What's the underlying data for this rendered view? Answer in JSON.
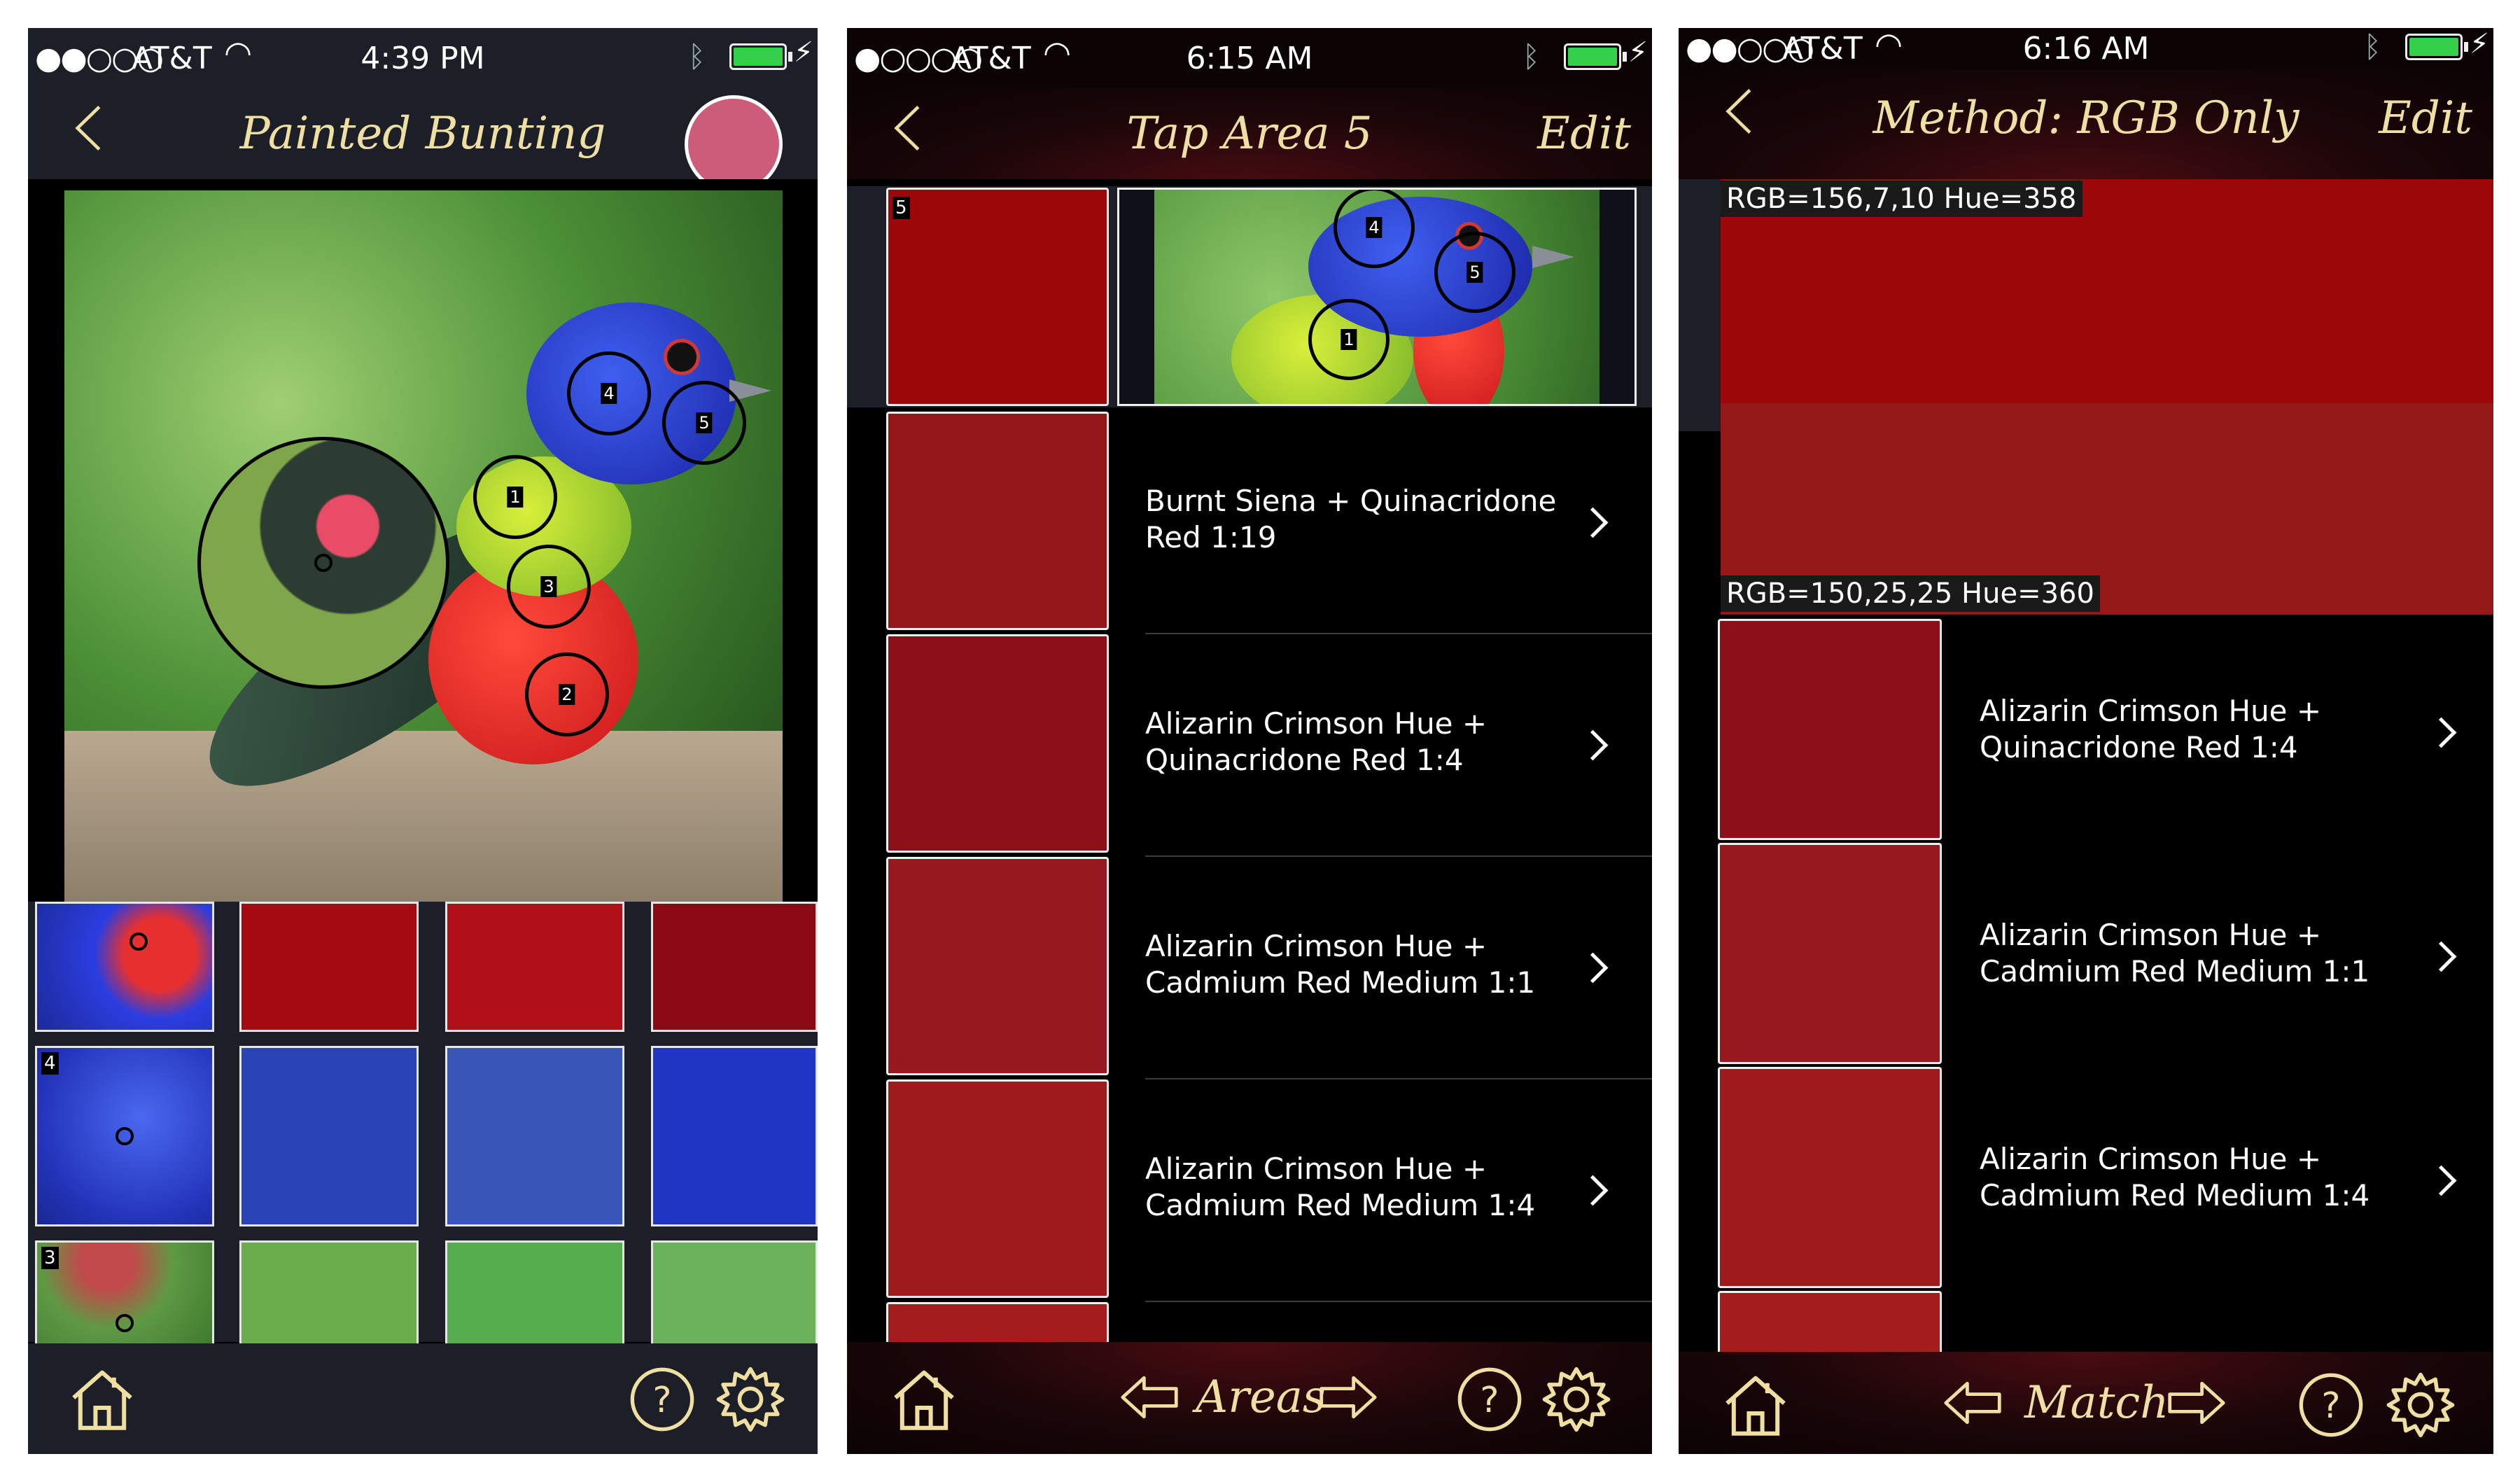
{
  "screens": [
    {
      "status": {
        "signal": "●●○○○",
        "carrier": "AT&T",
        "time": "4:39 PM"
      },
      "nav": {
        "title": "Painted Bunting"
      },
      "marks": [
        "1",
        "2",
        "3",
        "4",
        "5"
      ],
      "grid_tags": [
        "4",
        "3"
      ],
      "colors": {
        "row1": [
          "#a50a12",
          "#b01018",
          "#8a0912"
        ],
        "row2": [
          "#2a44b6",
          "#3a55b8",
          "#1f35c4"
        ],
        "row3": [
          "#6aad4c",
          "#56ad4e",
          "#6cb25a"
        ]
      }
    },
    {
      "status": {
        "signal": "●○○○○",
        "carrier": "AT&T",
        "time": "6:15 AM"
      },
      "nav": {
        "title": "Tap Area 5",
        "edit": "Edit"
      },
      "top_tag": "5",
      "thumb_marks": [
        "4",
        "5",
        "1"
      ],
      "items": [
        {
          "line1": "Burnt Siena + Quinacridone",
          "line2": "Red 1:19",
          "color": "#951619"
        },
        {
          "line1": "Alizarin Crimson Hue +",
          "line2": "Quinacridone Red 1:4",
          "color": "#8b1018"
        },
        {
          "line1": "Alizarin Crimson Hue +",
          "line2": "Cadmium Red Medium 1:1",
          "color": "#981820"
        },
        {
          "line1": "Alizarin Crimson Hue +",
          "line2": "Cadmium Red Medium 1:4",
          "color": "#9e1a1d"
        }
      ],
      "target_color": "#9c070a",
      "tab": {
        "label": "Areas"
      }
    },
    {
      "status": {
        "signal": "●●○○○",
        "carrier": "AT&T",
        "time": "6:16 AM"
      },
      "nav": {
        "title": "Method: RGB Only",
        "edit": "Edit"
      },
      "target": {
        "label": "RGB=156,7,10 Hue=358",
        "color": "#9c070a"
      },
      "match": {
        "label": "RGB=150,25,25 Hue=360",
        "color": "#961919"
      },
      "items": [
        {
          "line1": "Alizarin Crimson Hue +",
          "line2": "Quinacridone Red 1:4",
          "color": "#8b1018"
        },
        {
          "line1": "Alizarin Crimson Hue +",
          "line2": "Cadmium Red Medium 1:1",
          "color": "#981820"
        },
        {
          "line1": "Alizarin Crimson Hue +",
          "line2": "Cadmium Red Medium 1:4",
          "color": "#9e1a1d"
        }
      ],
      "tab": {
        "label": "Match"
      }
    }
  ],
  "icons": [
    "back-chevron-icon",
    "home-icon",
    "help-icon",
    "gear-icon",
    "arrow-left-icon",
    "arrow-right-icon",
    "wifi-icon",
    "bluetooth-icon",
    "battery-icon"
  ]
}
